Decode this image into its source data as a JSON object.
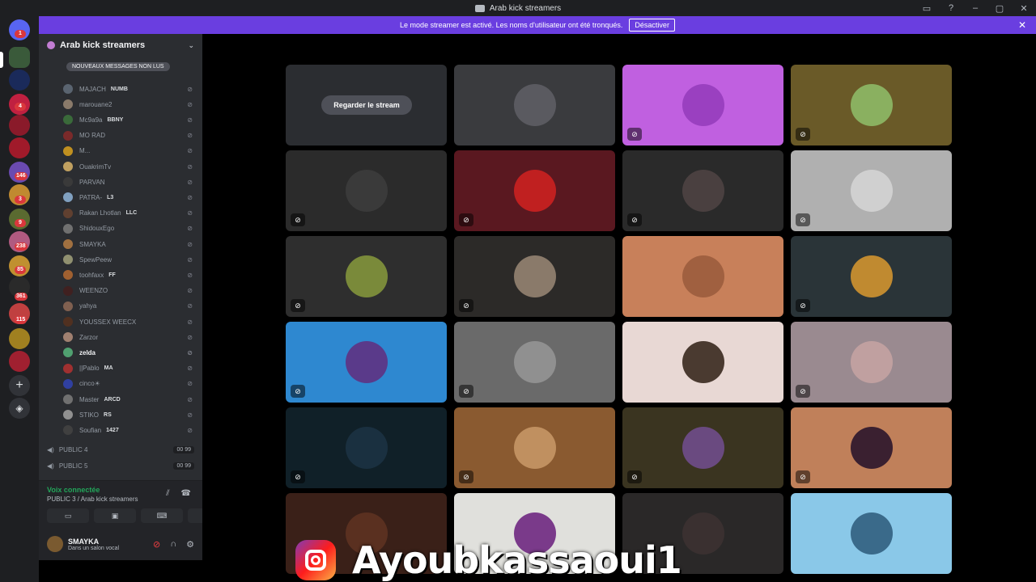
{
  "window": {
    "title": "Arab kick streamers"
  },
  "banner": {
    "text": "Le mode streamer est activé. Les noms d'utilisateur ont été tronqués.",
    "button": "Désactiver"
  },
  "server_badges": [
    "1",
    "4",
    "146",
    "3",
    "9",
    "238",
    "85",
    "361",
    "115"
  ],
  "guild": {
    "name": "Arab kick streamers"
  },
  "unread_pill": "NOUVEAUX MESSAGES NON LUS",
  "members": [
    {
      "name": "MAJACH",
      "tag": "NUMB",
      "color": "#5a6470"
    },
    {
      "name": "marouane2",
      "tag": "",
      "color": "#8a7a6a"
    },
    {
      "name": "Mc9a9a",
      "tag": "BBNY",
      "color": "#3a6a3a"
    },
    {
      "name": "MO RAD",
      "tag": "",
      "color": "#7a2a2a"
    },
    {
      "name": "M...",
      "tag": "",
      "color": "#c09020"
    },
    {
      "name": "OuakrimTv",
      "tag": "",
      "color": "#c0a060"
    },
    {
      "name": "PARVAN",
      "tag": "",
      "color": "#3a3a3a"
    },
    {
      "name": "PATRA-",
      "tag": "L3",
      "color": "#80a0c0"
    },
    {
      "name": "Rakan Lhotlan",
      "tag": "LLC",
      "color": "#604030"
    },
    {
      "name": "ShidouxEgo",
      "tag": "",
      "color": "#707070"
    },
    {
      "name": "SMAYKA",
      "tag": "",
      "color": "#a07040"
    },
    {
      "name": "SpewPeew",
      "tag": "",
      "color": "#909070"
    },
    {
      "name": "toohfaxx",
      "tag": "FF",
      "color": "#a06030"
    },
    {
      "name": "WEENZO",
      "tag": "",
      "color": "#402020"
    },
    {
      "name": "yahya",
      "tag": "",
      "color": "#806050"
    },
    {
      "name": "YOUSSEX WEECX",
      "tag": "",
      "color": "#503020"
    },
    {
      "name": "Zarzor",
      "tag": "",
      "color": "#a08070"
    },
    {
      "name": "zelda",
      "tag": "",
      "color": "#50a070"
    },
    {
      "name": "||Pablo",
      "tag": "MA",
      "color": "#a03030"
    },
    {
      "name": "cinco☀",
      "tag": "",
      "color": "#3040a0"
    },
    {
      "name": "Master",
      "tag": "ARCD",
      "color": "#707070"
    },
    {
      "name": "STIKO",
      "tag": "RS",
      "color": "#909090"
    },
    {
      "name": "Soufian",
      "tag": "1427",
      "color": "#404040"
    }
  ],
  "channels": [
    {
      "name": "PUBLIC 4",
      "c1": "00",
      "c2": "99"
    },
    {
      "name": "PUBLIC 5",
      "c1": "00",
      "c2": "99"
    }
  ],
  "voice": {
    "status": "Voix connectée",
    "channel": "PUBLIC 3 / Arab kick streamers"
  },
  "user": {
    "name": "SMAYKA",
    "status": "Dans un salon vocal"
  },
  "stream": {
    "watch_label": "Regarder le stream"
  },
  "tiles": [
    {
      "bg": "#2b2d31",
      "av": "#2b2d31",
      "mute": ""
    },
    {
      "bg": "#3a3b3e",
      "av": "#5a5a60",
      "mute": ""
    },
    {
      "bg": "#c060e0",
      "av": "#9a40c0",
      "mute": "⊘"
    },
    {
      "bg": "#6a5a28",
      "av": "#8ab060",
      "mute": "⊘"
    },
    {
      "bg": "#2b2b2b",
      "av": "#3a3a3a",
      "mute": "⊘"
    },
    {
      "bg": "#5a1820",
      "av": "#c02020",
      "mute": "⊘"
    },
    {
      "bg": "#2a2a2a",
      "av": "#4a4040",
      "mute": "⊘"
    },
    {
      "bg": "#b0b0b0",
      "av": "#d0d0d0",
      "mute": "⊘"
    },
    {
      "bg": "#2e2e2e",
      "av": "#7a8a3a",
      "mute": "⊘"
    },
    {
      "bg": "#2c2a28",
      "av": "#8a7a6a",
      "mute": "⊘"
    },
    {
      "bg": "#c8805a",
      "av": "#a06040",
      "mute": ""
    },
    {
      "bg": "#2a3438",
      "av": "#c08a30",
      "mute": "⊘"
    },
    {
      "bg": "#2e88d0",
      "av": "#5a3a8a",
      "mute": "⊘"
    },
    {
      "bg": "#6a6a6a",
      "av": "#909090",
      "mute": "⊘"
    },
    {
      "bg": "#e8d8d4",
      "av": "#4a3a30",
      "mute": ""
    },
    {
      "bg": "#9a8a90",
      "av": "#c0a0a0",
      "mute": "⊘"
    },
    {
      "bg": "#102028",
      "av": "#1a3040",
      "mute": "⊘"
    },
    {
      "bg": "#8a5a30",
      "av": "#c09060",
      "mute": "⊘"
    },
    {
      "bg": "#3a3420",
      "av": "#6a4a80",
      "mute": "⊘"
    },
    {
      "bg": "#c0805a",
      "av": "#3a2030",
      "mute": "⊘"
    },
    {
      "bg": "#3a2018",
      "av": "#5a3020",
      "mute": ""
    },
    {
      "bg": "#e0e0dc",
      "av": "#7a3a8a",
      "mute": ""
    },
    {
      "bg": "#2a2828",
      "av": "#3a3030",
      "mute": ""
    },
    {
      "bg": "#8ac8e8",
      "av": "#3a6a8a",
      "mute": ""
    }
  ],
  "overlay": {
    "handle": "Ayoubkassaoui1"
  }
}
